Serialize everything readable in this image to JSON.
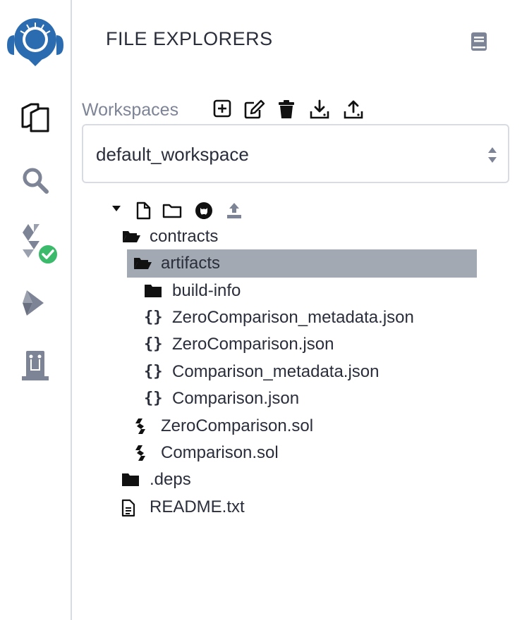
{
  "panel": {
    "title": "FILE EXPLORERS"
  },
  "workspaces": {
    "label": "Workspaces",
    "selected": "default_workspace"
  },
  "tree": {
    "contracts": "contracts",
    "artifacts": "artifacts",
    "build_info": "build-info",
    "zc_meta": "ZeroComparison_metadata.json",
    "zc_json": "ZeroComparison.json",
    "c_meta": "Comparison_metadata.json",
    "c_json": "Comparison.json",
    "zc_sol": "ZeroComparison.sol",
    "c_sol": "Comparison.sol",
    "deps": ".deps",
    "readme": "README.txt"
  },
  "icons": {
    "brand": "remix-logo",
    "sidebar": [
      "file-explorer-icon",
      "search-icon",
      "solidity-compiler-icon",
      "deploy-run-icon",
      "plugin-manager-icon"
    ],
    "workspace_actions": [
      "add-workspace-icon",
      "edit-workspace-icon",
      "delete-workspace-icon",
      "download-workspace-icon",
      "upload-workspace-icon"
    ],
    "tree_actions": [
      "new-file-icon",
      "new-folder-icon",
      "github-icon",
      "upload-file-icon"
    ]
  },
  "colors": {
    "selection": "#a2a9b3",
    "brand_blue": "#2b6cb0",
    "check_green": "#3cba6b"
  }
}
